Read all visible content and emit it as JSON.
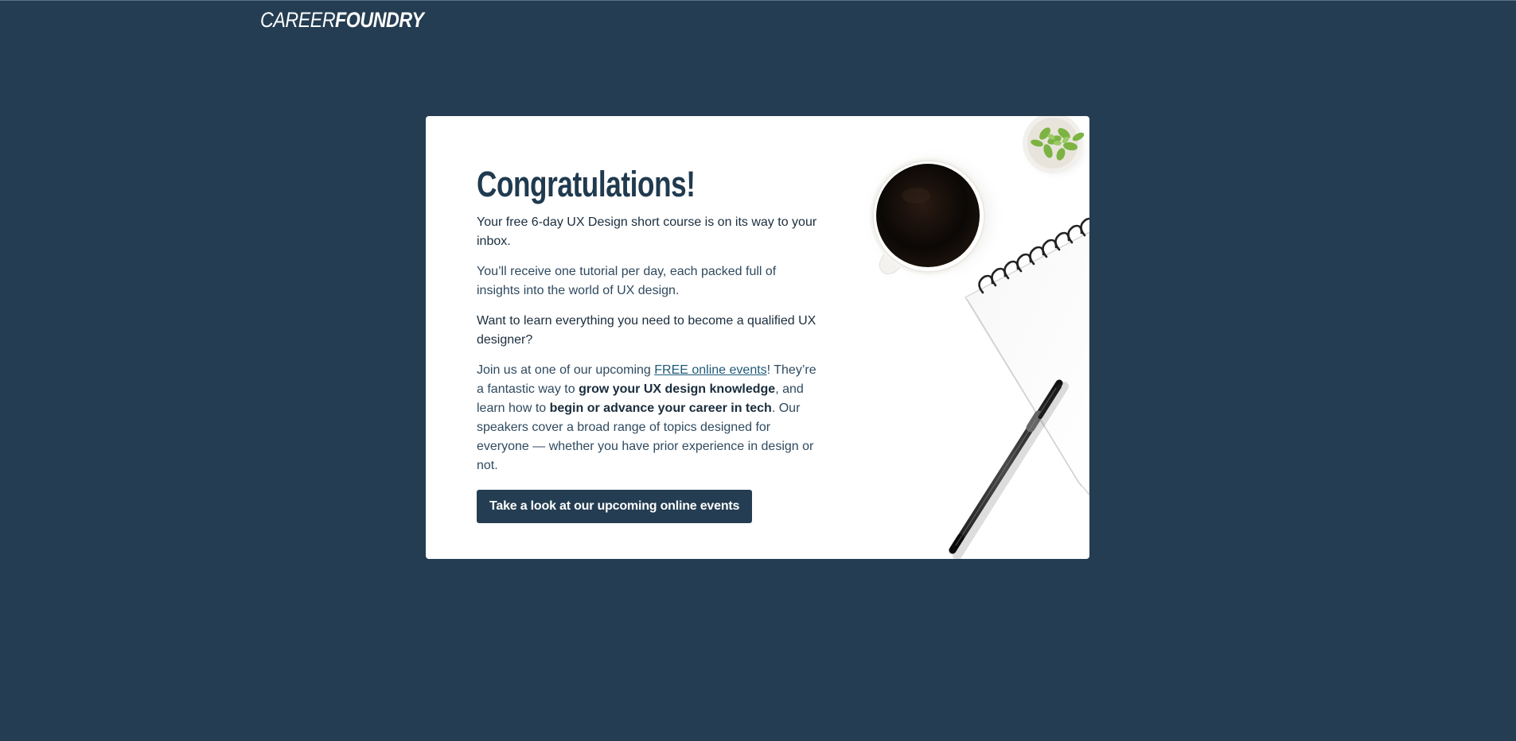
{
  "header": {
    "logo_light": "CAREER",
    "logo_bold": "FOUNDRY"
  },
  "card": {
    "heading": "Congratulations!",
    "paragraph_1": "Your free 6-day UX Design short course is on its way to your inbox.",
    "paragraph_2": "You’ll receive one tutorial per day, each packed full of insights into the world of UX design.",
    "paragraph_3": "Want to learn everything you need to become a qualified UX designer?",
    "paragraph_4": {
      "part_1": "Join us at one of our upcoming ",
      "link_text": "FREE online events",
      "part_2": "! They’re a fantastic way to ",
      "bold_1": "grow your UX design knowledge",
      "part_3": ", and learn how to ",
      "bold_2": "begin or advance your career in tech",
      "part_4": ". Our speakers cover a broad range of topics designed for everyone — whether you have prior experience in design or not."
    },
    "cta_label": "Take a look at our upcoming online events"
  },
  "colors": {
    "background": "#243d52",
    "card": "#ffffff",
    "heading": "#203a4f",
    "link": "#1e5a78",
    "button": "#243d52"
  },
  "icons": {
    "illustration": "coffee-notebook-plant-illustration"
  }
}
